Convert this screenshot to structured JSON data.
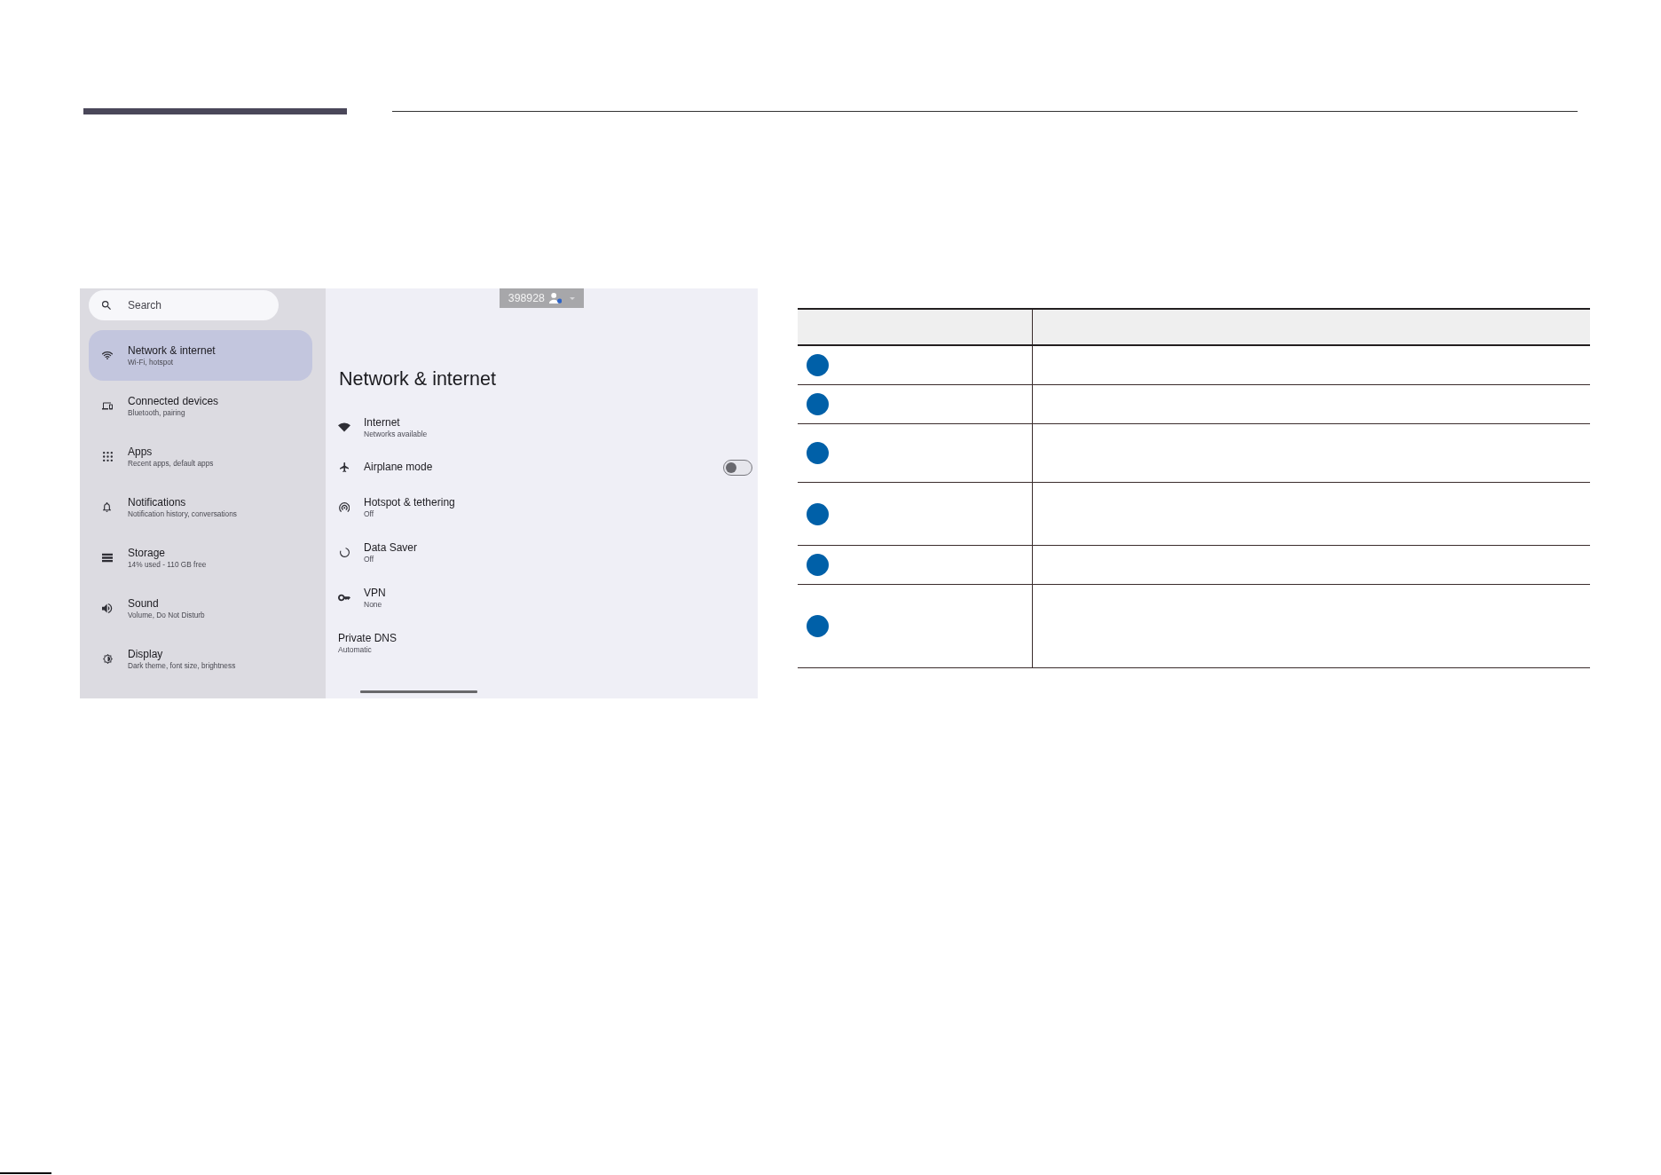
{
  "screenshot": {
    "search": {
      "placeholder": "Search"
    },
    "sidebar": {
      "items": [
        {
          "title": "Network & internet",
          "subtitle": "Wi-Fi, hotspot",
          "selected": true
        },
        {
          "title": "Connected devices",
          "subtitle": "Bluetooth, pairing",
          "selected": false
        },
        {
          "title": "Apps",
          "subtitle": "Recent apps, default apps",
          "selected": false
        },
        {
          "title": "Notifications",
          "subtitle": "Notification history, conversations",
          "selected": false
        },
        {
          "title": "Storage",
          "subtitle": "14% used - 110 GB free",
          "selected": false
        },
        {
          "title": "Sound",
          "subtitle": "Volume, Do Not Disturb",
          "selected": false
        },
        {
          "title": "Display",
          "subtitle": "Dark theme, font size, brightness",
          "selected": false
        }
      ]
    },
    "account_chip": {
      "label": "398928"
    },
    "page": {
      "title": "Network & internet",
      "items": [
        {
          "kind": "link",
          "title": "Internet",
          "subtitle": "Networks available"
        },
        {
          "kind": "toggle",
          "title": "Airplane mode",
          "on": false
        },
        {
          "kind": "link",
          "title": "Hotspot & tethering",
          "subtitle": "Off"
        },
        {
          "kind": "link",
          "title": "Data Saver",
          "subtitle": "Off"
        },
        {
          "kind": "link",
          "title": "VPN",
          "subtitle": "None"
        },
        {
          "kind": "plain",
          "title": "Private DNS",
          "subtitle": "Automatic"
        }
      ]
    }
  },
  "table": {
    "rows": [
      {
        "kind": "short",
        "marker": true
      },
      {
        "kind": "short",
        "marker": true
      },
      {
        "kind": "medium",
        "marker": true
      },
      {
        "kind": "tall",
        "marker": true
      },
      {
        "kind": "short",
        "marker": true
      },
      {
        "kind": "extra-tall",
        "marker": true
      }
    ]
  }
}
